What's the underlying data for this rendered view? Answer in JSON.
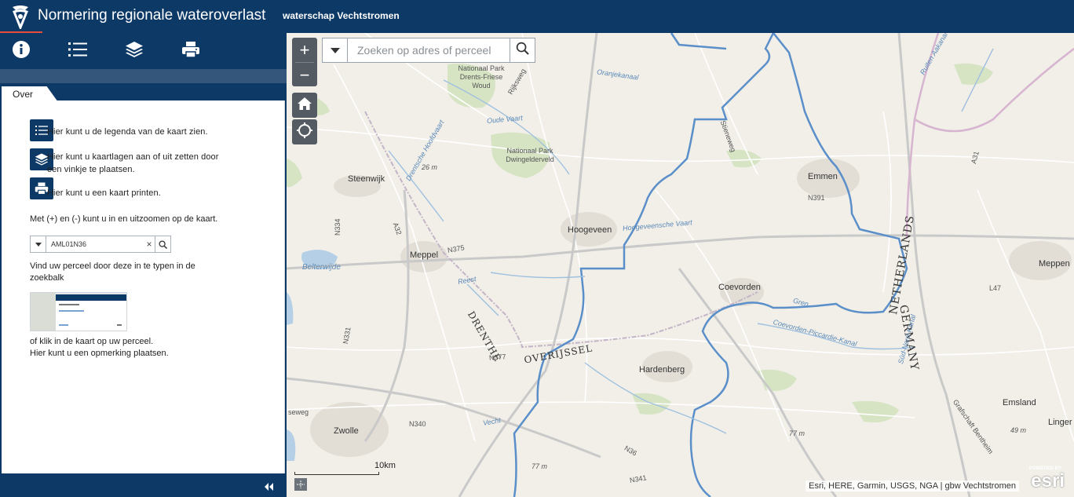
{
  "header": {
    "title": "Normering regionale wateroverlast",
    "subtitle": "waterschap Vechtstromen"
  },
  "toolbar": {
    "tools": [
      {
        "name": "info",
        "icon": "info-icon"
      },
      {
        "name": "legend",
        "icon": "list-icon"
      },
      {
        "name": "layers",
        "icon": "layers-icon"
      },
      {
        "name": "print",
        "icon": "printer-icon"
      }
    ]
  },
  "panel": {
    "tab_label": "Over",
    "legend_rows": [
      {
        "icon": "list-icon",
        "text": "Hier kunt u de legenda van de kaart zien."
      },
      {
        "icon": "layers-icon",
        "text": "Hier kunt u kaartlagen aan of uit zetten door een vinkje te plaatsen."
      },
      {
        "icon": "printer-icon",
        "text": "Hier kunt u een kaart printen."
      }
    ],
    "zoom_text": "Met (+) en (-) kunt u in en uitzoomen op de kaart.",
    "example_search_value": "AML01N36",
    "find_text": "Vind uw perceel door deze in te typen in de zoekbalk",
    "click_text": "of klik in de kaart op uw perceel.",
    "remark_text": "Hier kunt u een opmerking plaatsen."
  },
  "map": {
    "zoom_in": "+",
    "zoom_out": "−",
    "search_placeholder": "Zoeken op adres of perceel",
    "scale_label": "10km",
    "attribution": "Esri, HERE, Garmin, USGS, NGA | gbw Vechtstromen",
    "esri_powered": "POWERED BY",
    "esri_word": "esri",
    "labels": {
      "park1": "Nationaal Park Drents-Friese Woud",
      "park2": "Nationaal Park Dwingelderveld",
      "steenwijk": "Steenwijk",
      "meppel": "Meppel",
      "hoogeveen": "Hoogeveen",
      "emmen": "Emmen",
      "coevorden": "Coevorden",
      "hardenberg": "Hardenberg",
      "zwolle": "Zwolle",
      "emsland": "Emsland",
      "meppen": "Meppen",
      "lingen": "Linger",
      "drenthe": "DRENTHE",
      "overijssel": "OVERIJSSEL",
      "netherlands": "NETHERLANDS",
      "germany": "GERMANY",
      "belterwijde": "Belterwijde",
      "oude_vaart": "Oude Vaart",
      "oranjekanaal": "Oranjekanaal",
      "hoogeveensche_vaart": "Hoogeveensche Vaart",
      "reest": "Reest",
      "vecht": "Vecht",
      "coevorden_kanaal": "Coevorden-Piccardie-Kanal",
      "drentsche_hoofdvaart": "Drentsche Hoofdvaart",
      "sud_nord_kanal": "Süd-Nord-Kanal",
      "ruiten_aa": "Ruiten Aakanal",
      "grafschaft": "Grafschaft Bentheim",
      "stieneweg": "Stieneweg",
      "rijksweg": "Rijksweg",
      "n391": "N391",
      "n375": "N375",
      "n377": "N377",
      "n340": "N340",
      "n36": "N36",
      "n341": "N341",
      "n334": "N334",
      "n331": "N331",
      "a32": "A32",
      "a31": "A31",
      "l47": "L47",
      "e26m": "26 m",
      "e77m": "77 m",
      "e49m": "49 m",
      "e77m_b": "77 m",
      "seweg": "seweg",
      "gren": "Gren"
    }
  },
  "colors": {
    "header_bg": "#0d3966",
    "accent": "#e84c3d",
    "boundary": "#5b8fc9",
    "road": "#ffffff",
    "map_bg": "#f1efe8"
  }
}
